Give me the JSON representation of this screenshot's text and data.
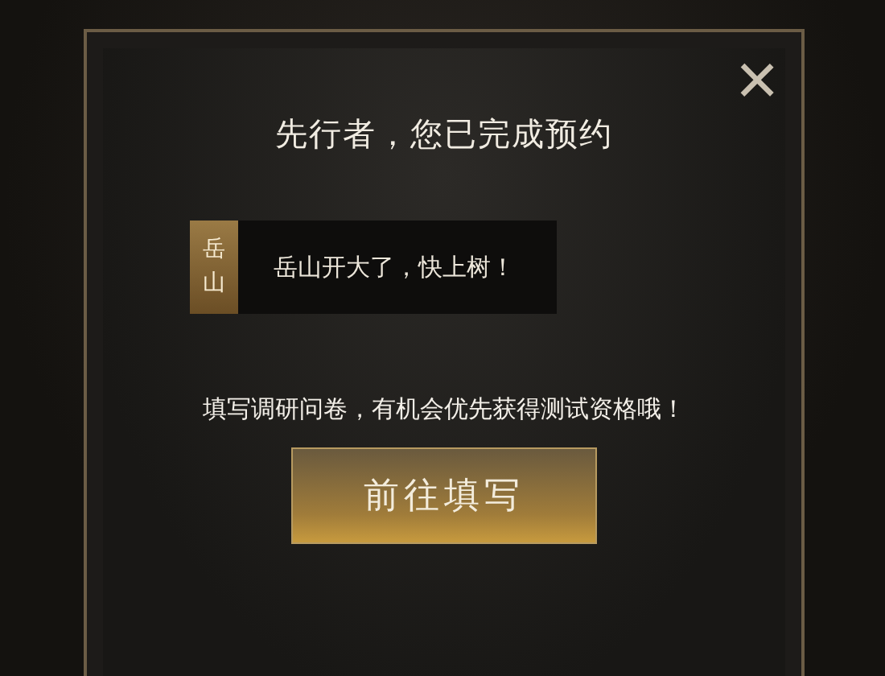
{
  "dialog": {
    "title": "先行者，您已完成预约",
    "close": "×",
    "quote": {
      "speaker": "岳山",
      "text": "岳山开大了，快上树！"
    },
    "prompt": "填写调研问卷，有机会优先获得测试资格哦！",
    "button": "前往填写"
  }
}
